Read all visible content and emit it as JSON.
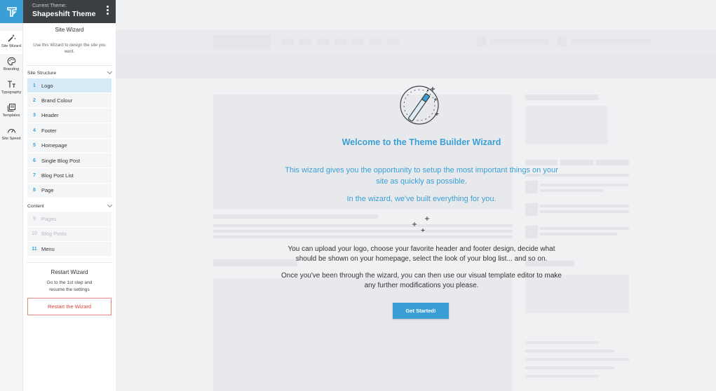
{
  "header": {
    "caption": "Current Theme:",
    "theme_name": "Shapeshift Theme"
  },
  "rail": [
    {
      "label": "Site Wizard",
      "icon": "magic-wand-icon"
    },
    {
      "label": "Branding",
      "icon": "palette-icon"
    },
    {
      "label": "Typography",
      "icon": "typography-icon"
    },
    {
      "label": "Templates",
      "icon": "templates-icon"
    },
    {
      "label": "Site Speed",
      "icon": "speedometer-icon"
    }
  ],
  "panel": {
    "title": "Site Wizard",
    "description": "Use this Wizard to design the site you want.",
    "site_structure": {
      "title": "Site Structure",
      "steps": [
        {
          "num": "1",
          "label": "Logo"
        },
        {
          "num": "2",
          "label": "Brand Colour"
        },
        {
          "num": "3",
          "label": "Header"
        },
        {
          "num": "4",
          "label": "Footer"
        },
        {
          "num": "5",
          "label": "Homepage"
        },
        {
          "num": "6",
          "label": "Single Blog Post"
        },
        {
          "num": "7",
          "label": "Blog Post List"
        },
        {
          "num": "8",
          "label": "Page"
        }
      ]
    },
    "content": {
      "title": "Content",
      "steps": [
        {
          "num": "9",
          "label": "Pages"
        },
        {
          "num": "10",
          "label": "Blog Posts"
        },
        {
          "num": "11",
          "label": "Menu"
        }
      ]
    },
    "restart": {
      "title": "Restart Wizard",
      "description": "Go to the 1st step and resume the settings",
      "button": "Restart the Wizard"
    }
  },
  "welcome": {
    "title": "Welcome to the Theme Builder Wizard",
    "intro": "This wizard gives you the opportunity to setup the most important things on your site as quickly as possible.",
    "built": "In the wizard, we've built everything for you.",
    "details": "You can upload your logo, choose your favorite header and footer design, decide what should be shown on your homepage, select the look of your blog list... and so on.",
    "modify": "Once you've been through the wizard, you can then use our visual template editor to make any further modifications you please.",
    "button": "Get Started!"
  },
  "colors": {
    "accent": "#3a9fd4",
    "header_bg": "#3c3f44",
    "restart_red": "#d8443a",
    "active_step_bg": "#d7eaf7"
  }
}
